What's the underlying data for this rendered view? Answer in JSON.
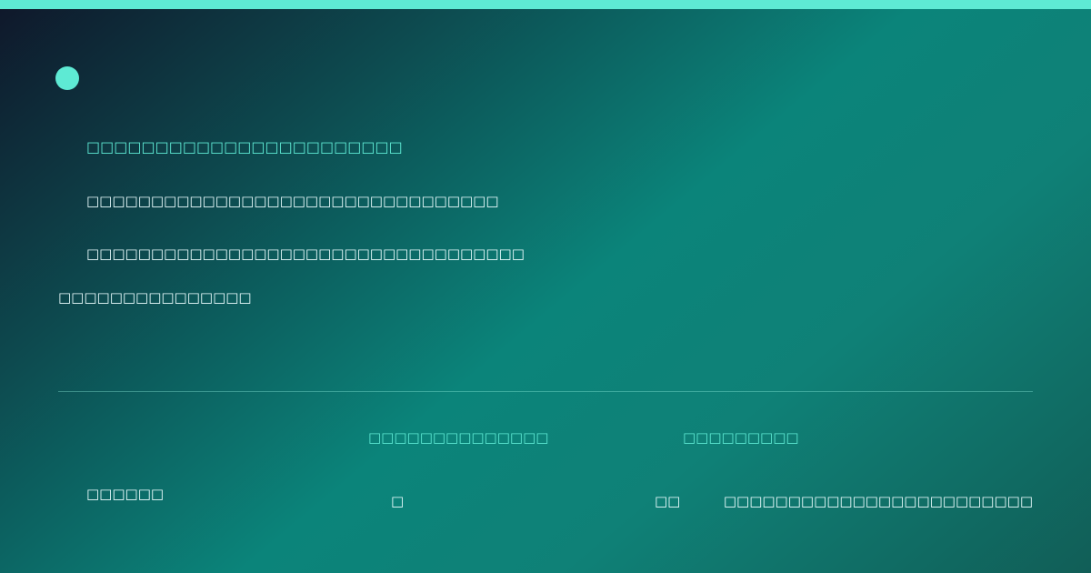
{
  "colors": {
    "accent": "#5eead4",
    "text": "#ecfeff",
    "background_dark": "#0f172a",
    "background_teal": "#0b847a"
  },
  "header": {
    "line1": "□□□□□□□□□□□□□□□□□□□□□□□",
    "line2": "□□□□□□□□□□□□□□□□□□□□□□□□□□□□□□□□",
    "line3": "□□□□□□□□□□□□□□□□□□□□□□□□□□□□□□□□□□",
    "line4": "□□□□□□□□□□□□□□□"
  },
  "footer": {
    "headers": [
      "□□□□□□□□□□□□□□",
      "□□□□□□□□□"
    ],
    "row": [
      "□□□□□□",
      "□",
      "□□",
      "□□□□□□□□□□□□□□□□□□□□□□□□"
    ]
  }
}
